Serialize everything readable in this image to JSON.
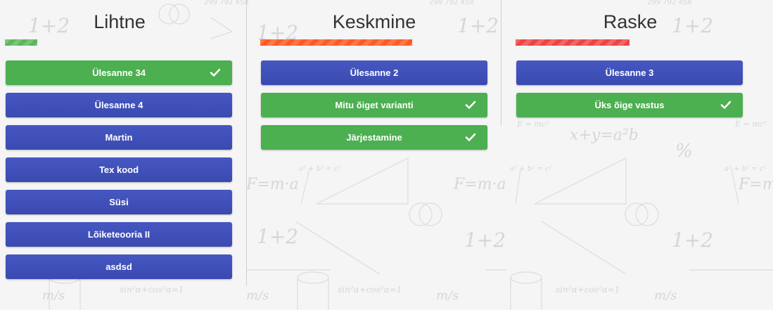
{
  "columns": [
    {
      "title": "Lihtne",
      "progress_color": "#5cb85c",
      "progress_fraction": 0.14,
      "tasks": [
        {
          "label": "Ülesanne 34",
          "completed": true
        },
        {
          "label": "Ülesanne 4",
          "completed": false
        },
        {
          "label": "Martin",
          "completed": false
        },
        {
          "label": "Tex kood",
          "completed": false
        },
        {
          "label": "Süsi",
          "completed": false
        },
        {
          "label": "Lõiketeooria II",
          "completed": false
        },
        {
          "label": "asdsd",
          "completed": false
        }
      ]
    },
    {
      "title": "Keskmine",
      "progress_color": "#ff5a22",
      "progress_fraction": 0.67,
      "tasks": [
        {
          "label": "Ülesanne 2",
          "completed": false
        },
        {
          "label": "Mitu õiget varianti",
          "completed": true
        },
        {
          "label": "Järjestamine",
          "completed": true
        }
      ]
    },
    {
      "title": "Raske",
      "progress_color": "#ee4444",
      "progress_fraction": 0.5,
      "tasks": [
        {
          "label": "Ülesanne 3",
          "completed": false
        },
        {
          "label": "Üks õige vastus",
          "completed": true
        }
      ]
    }
  ],
  "colors": {
    "task_pending": "#3f51b5",
    "task_completed": "#4caf50"
  },
  "icons": {
    "completed": "check-icon"
  }
}
